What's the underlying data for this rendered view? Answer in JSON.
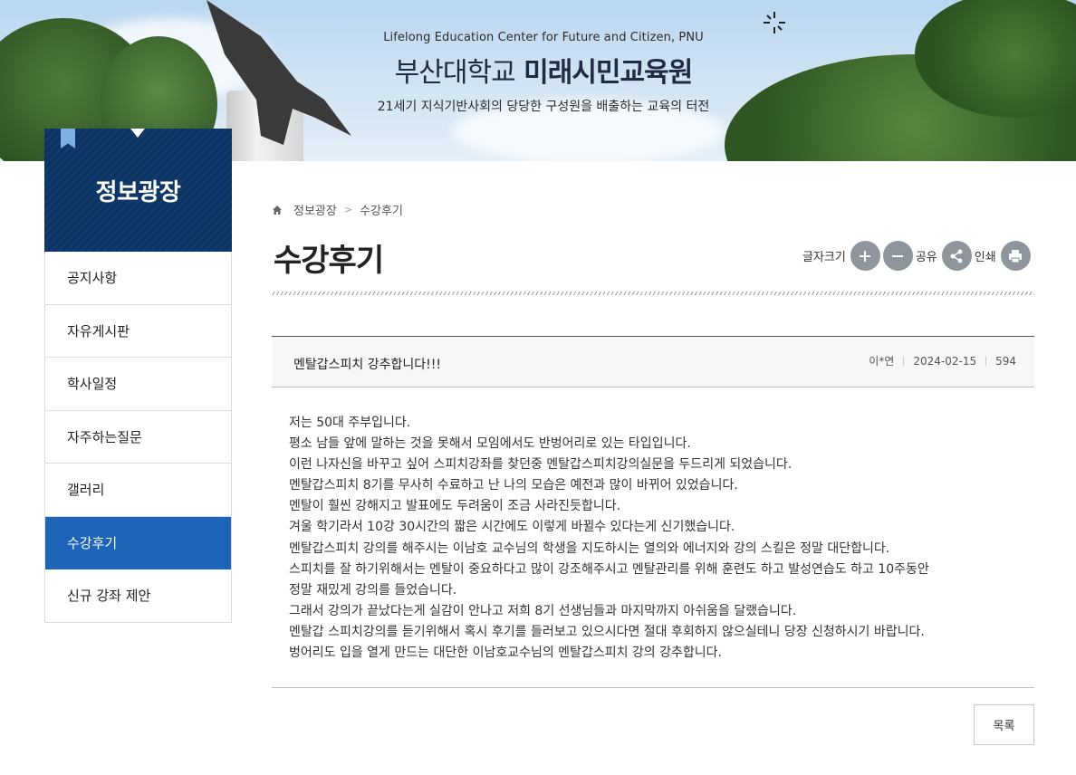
{
  "banner": {
    "en_title": "Lifelong Education Center for Future and Citizen, PNU",
    "ko_title_part1": "부산대학교",
    "ko_title_part2": "미래시민교육원",
    "subtitle": "21세기 지식기반사회의 당당한 구성원을 배출하는 교육의 터전"
  },
  "sidebar": {
    "title": "정보광장",
    "items": [
      {
        "label": "공지사항",
        "active": false
      },
      {
        "label": "자유게시판",
        "active": false
      },
      {
        "label": "학사일정",
        "active": false
      },
      {
        "label": "자주하는질문",
        "active": false
      },
      {
        "label": "갤러리",
        "active": false
      },
      {
        "label": "수강후기",
        "active": true
      },
      {
        "label": "신규 강좌 제안",
        "active": false
      }
    ]
  },
  "breadcrumb": {
    "items": [
      "정보광장",
      "수강후기"
    ],
    "separator": ">"
  },
  "page": {
    "title": "수강후기"
  },
  "tools": {
    "font_size_label": "글자크기",
    "share_label": "공유",
    "print_label": "인쇄"
  },
  "post": {
    "title": "멘탈갑스피치 강추합니다!!!",
    "author": "이*연",
    "date": "2024-02-15",
    "views": "594",
    "body": [
      "저는 50대 주부입니다.",
      "평소 남들 앞에 말하는 것을 못해서 모임에서도 반벙어리로 있는 타입입니다.",
      "이런 나자신을 바꾸고 싶어 스피치강좌를 찾던중 멘탈갑스피치강의실문을 두드리게 되었습니다.",
      "멘탈갑스피치 8기를 무사히 수료하고 난 나의 모습은 예전과 많이 바뀌어 있었습니다.",
      "멘탈이 훨씬 강해지고  발표에도 두려움이 조금 사라진듯합니다.",
      "겨울 학기라서 10강 30시간의 짧은 시간에도 이렇게 바뀔수 있다는게 신기했습니다.",
      "멘탈갑스피치 강의를 해주시는 이남호 교수님의 학생을 지도하시는 열의와 에너지와 강의 스킬은 정말 대단합니다.",
      "스피치를 잘 하기위해서는 멘탈이 중요하다고 많이 강조해주시고 멘탈관리를 위해 훈련도 하고 발성연습도 하고 10주동안",
      "정말 재밌게 강의를 들었습니다.",
      "그래서 강의가 끝났다는게 실감이 안나고 저희 8기 선생님들과 마지막까지 아쉬움을 달랬습니다.",
      "멘탈갑 스피치강의를 듣기위해서 혹시 후기를 들러보고 있으시다면 절대 후회하지 않으실테니 당장 신청하시기 바랍니다.",
      "벙어리도 입을 열게 만드는 대단한 이남호교수님의 멘탈갑스피치 강의 강추합니다."
    ]
  },
  "actions": {
    "list_label": "목록"
  },
  "icons": {
    "home": "home-icon",
    "plus": "plus-icon",
    "minus": "minus-icon",
    "share": "share-icon",
    "print": "print-icon"
  },
  "colors": {
    "sidebar_header": "#0d3461",
    "active_item": "#1b64b8",
    "tool_button": "#8e959c"
  }
}
